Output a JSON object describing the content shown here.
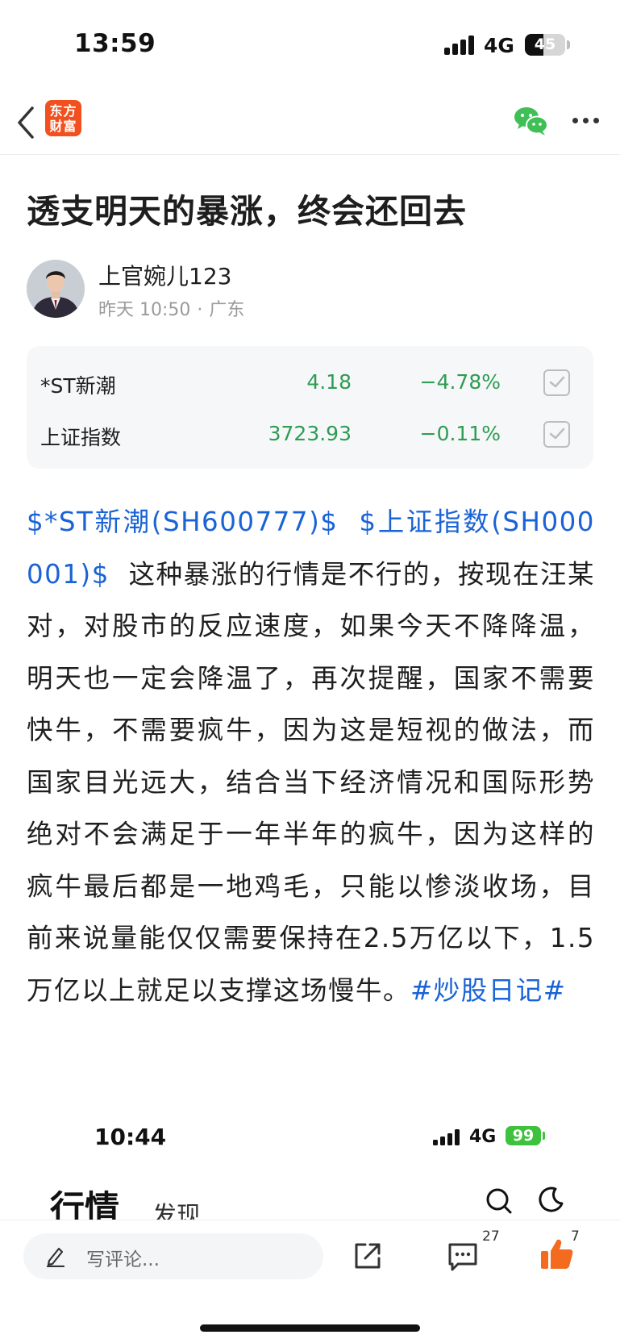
{
  "status_bar": {
    "time": "13:59",
    "network": "4G",
    "battery": "45",
    "battery_level": 0.45
  },
  "nav": {
    "logo_line1": "东方",
    "logo_line2": "财富"
  },
  "article": {
    "title": "透支明天的暴涨，终会还回去",
    "author": "上官婉儿123",
    "time": "昨天 10:50",
    "dot": "·",
    "location": "广东"
  },
  "stocks": [
    {
      "name": "*ST新潮",
      "price": "4.18",
      "change": "−4.78%",
      "checked": true
    },
    {
      "name": "上证指数",
      "price": "3723.93",
      "change": "−0.11%",
      "checked": true
    }
  ],
  "body": {
    "link1": "$*ST新潮(SH600777)$",
    "link2": "$上证指数(SH000001)$",
    "text": "这种暴涨的行情是不行的，按现在汪某对，对股市的反应速度，如果今天不降降温，明天也一定会降温了，再次提醒，国家不需要快牛，不需要疯牛，因为这是短视的做法，而国家目光远大，结合当下经济情况和国际形势绝对不会满足于一年半年的疯牛，因为这样的疯牛最后都是一地鸡毛，只能以惨淡收场，目前来说量能仅仅需要保持在2.5万亿以下，1.5万亿以上就足以支撑这场慢牛。",
    "hashtag": "#炒股日记#"
  },
  "embedded": {
    "time": "10:44",
    "network": "4G",
    "battery": "99",
    "tab_market": "行情",
    "tab_discover": "发现"
  },
  "bottom_bar": {
    "comment_placeholder": "写评论...",
    "comment_count": "27",
    "like_count": "7"
  },
  "colors": {
    "down_green": "#2e9c52",
    "link_blue": "#1a63d6",
    "brand_orange": "#f2501e",
    "like_orange": "#f46a1e",
    "wechat_green": "#3fbf55"
  }
}
